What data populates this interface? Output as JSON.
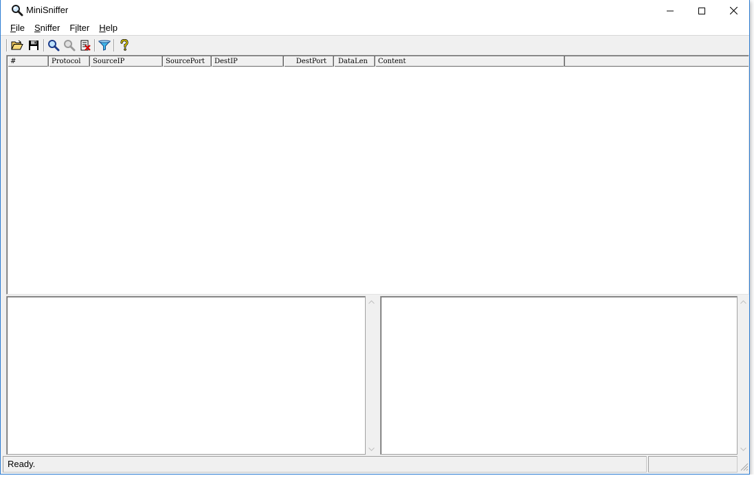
{
  "window": {
    "title": "MiniSniffer",
    "icon": "magnifier-icon",
    "controls": {
      "minimize": "minimize-icon",
      "maximize": "maximize-icon",
      "close": "close-icon"
    }
  },
  "menu": {
    "items": [
      {
        "label": "File",
        "mnemonic": "F",
        "rest": "ile"
      },
      {
        "label": "Sniffer",
        "mnemonic": "S",
        "rest": "niffer"
      },
      {
        "label": "Filter",
        "pre": "F",
        "mnemonic": "i",
        "rest": "lter"
      },
      {
        "label": "Help",
        "mnemonic": "H",
        "rest": "elp"
      }
    ]
  },
  "toolbar": {
    "buttons": [
      {
        "name": "open-button",
        "icon": "open-folder-icon"
      },
      {
        "name": "save-button",
        "icon": "floppy-disk-icon"
      },
      {
        "name": "start-sniff-button",
        "icon": "magnifier-icon"
      },
      {
        "name": "stop-sniff-button",
        "icon": "magnifier-disabled-icon"
      },
      {
        "name": "clear-button",
        "icon": "clear-list-icon"
      },
      {
        "name": "filter-button",
        "icon": "funnel-icon"
      },
      {
        "name": "help-button",
        "icon": "help-icon"
      }
    ]
  },
  "packet_list": {
    "columns": [
      "#",
      "Protocol",
      "SourceIP",
      "SourcePort",
      "DestIP",
      "DestPort",
      "DataLen",
      "Content"
    ],
    "rows": []
  },
  "status": {
    "text": "Ready.",
    "panel": ""
  },
  "colors": {
    "accent_border": "#2b7cd3",
    "chrome": "#f0f0f0"
  }
}
